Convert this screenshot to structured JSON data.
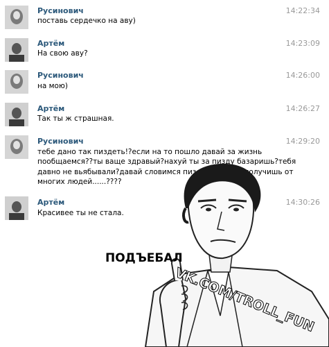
{
  "messages": [
    {
      "author": "Русинович",
      "time": "14:22:34",
      "lines": [
        "поставь сердечко на аву)"
      ]
    },
    {
      "author": "Артём",
      "time": "14:23:09",
      "lines": [
        "На свою аву?"
      ]
    },
    {
      "author": "Русинович",
      "time": "14:26:00",
      "lines": [
        "на мою)"
      ]
    },
    {
      "author": "Артём",
      "time": "14:26:27",
      "lines": [
        "Так ты ж страшная."
      ]
    },
    {
      "author": "Русинович",
      "time": "14:29:20",
      "lines": [
        "тебе дано так пиздеть!?если на то пошло давай за жизнь",
        "пообщаемся??ты ваще здравый?нахуй ты за пизду базаришь?тебя",
        "давно не вьябывали?давай словимся пизды за базар получишь от",
        "многих людей......????"
      ]
    },
    {
      "author": "Артём",
      "time": "14:30:26",
      "lines": [
        "Красивее ты не стала."
      ]
    }
  ],
  "meme": {
    "caption": "ПОДЪЕБАЛ",
    "watermark": "VK.COM/TROLL_FUN"
  }
}
